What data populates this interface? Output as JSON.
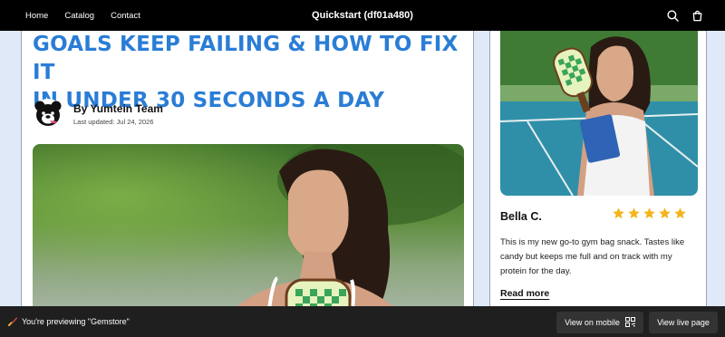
{
  "nav": {
    "links": [
      "Home",
      "Catalog",
      "Contact"
    ],
    "store_title": "Quickstart (df01a480)",
    "icons": [
      "search-icon",
      "cart-icon"
    ]
  },
  "article": {
    "headline_line1": "GOALS KEEP FAILING & HOW TO FIX IT",
    "headline_line2": "IN UNDER 30 SECONDS A DAY",
    "author": "By Yumtein Team",
    "updated": "Last updated: Jul 24, 2026",
    "headline_color": "#2a7dd6"
  },
  "review": {
    "name": "Bella C.",
    "rating": 5,
    "star_color": "#f2b51d",
    "text": "This is my new go-to gym bag snack. Tastes like candy but keeps me full and on track with my protein for the day.",
    "read_more": "Read more"
  },
  "preview": {
    "message": "You're previewing \"Gemstore\"",
    "mobile_button": "View on mobile",
    "live_button": "View live page"
  }
}
